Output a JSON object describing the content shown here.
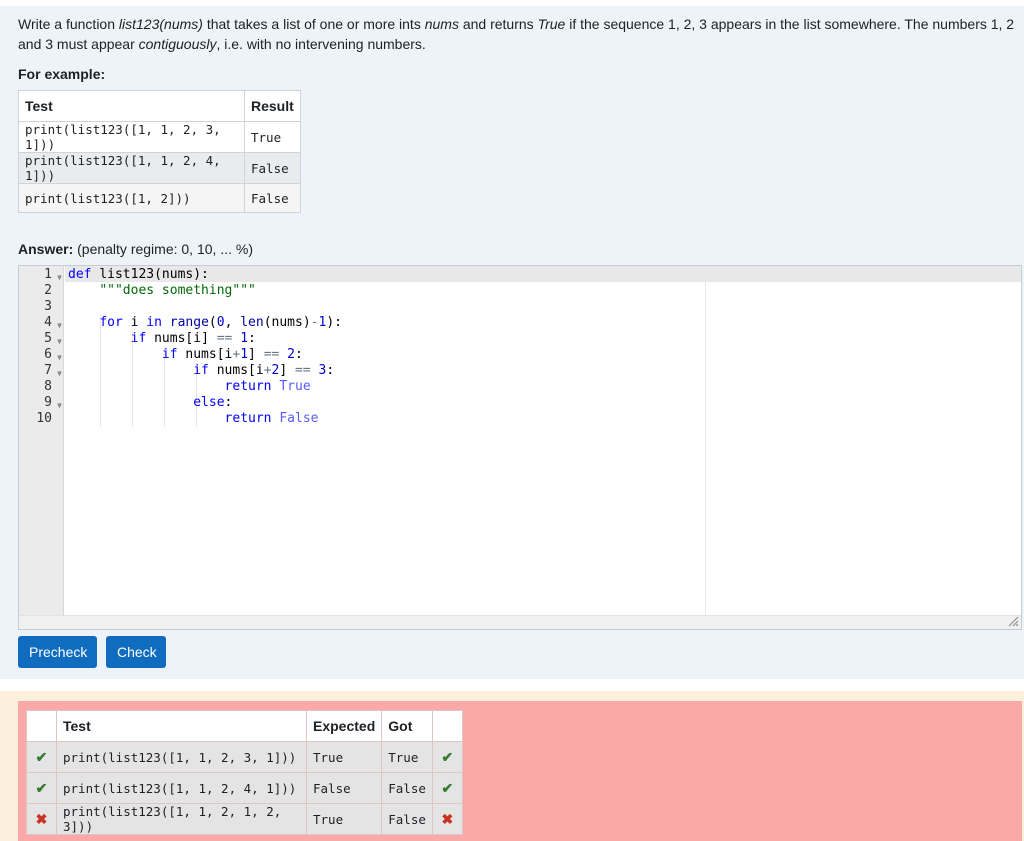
{
  "question": {
    "intro_1": "Write a function ",
    "fn_name": "list123(nums)",
    "intro_2": " that takes a list of one or more ints ",
    "nums_word": "nums",
    "intro_3": " and returns ",
    "true_word": "True",
    "intro_4": " if the sequence 1, 2, 3 appears in the list somewhere. The numbers 1, 2 and 3 must appear ",
    "contig_word": "contiguously",
    "intro_5": ", i.e. with no intervening numbers.",
    "for_example": "For example:"
  },
  "examples": {
    "headers": [
      "Test",
      "Result"
    ],
    "rows": [
      {
        "test": "print(list123([1, 1, 2, 3, 1]))",
        "result": "True"
      },
      {
        "test": "print(list123([1, 1, 2, 4, 1]))",
        "result": "False"
      },
      {
        "test": "print(list123([1, 2]))",
        "result": "False"
      }
    ]
  },
  "answer": {
    "label": "Answer:",
    "penalty": "(penalty regime: 0, 10, ... %)"
  },
  "editor": {
    "line_numbers": [
      "1",
      "2",
      "3",
      "4",
      "5",
      "6",
      "7",
      "8",
      "9",
      "10"
    ]
  },
  "buttons": {
    "precheck": "Precheck",
    "check": "Check"
  },
  "results": {
    "headers": [
      "",
      "Test",
      "Expected",
      "Got",
      ""
    ],
    "rows": [
      {
        "status": "pass",
        "test": "print(list123([1, 1, 2, 3, 1]))",
        "expected": "True",
        "got": "True"
      },
      {
        "status": "pass",
        "test": "print(list123([1, 1, 2, 4, 1]))",
        "expected": "False",
        "got": "False"
      },
      {
        "status": "fail",
        "test": "print(list123([1, 1, 2, 1, 2, 3]))",
        "expected": "True",
        "got": "False"
      }
    ]
  },
  "colors": {
    "button": "#0f6cbf",
    "results_fail_bg": "#faa9a9",
    "results_outer_bg": "#fcefdc",
    "question_bg": "#eef3f9",
    "pass": "#357a32",
    "fail": "#ca3120"
  }
}
